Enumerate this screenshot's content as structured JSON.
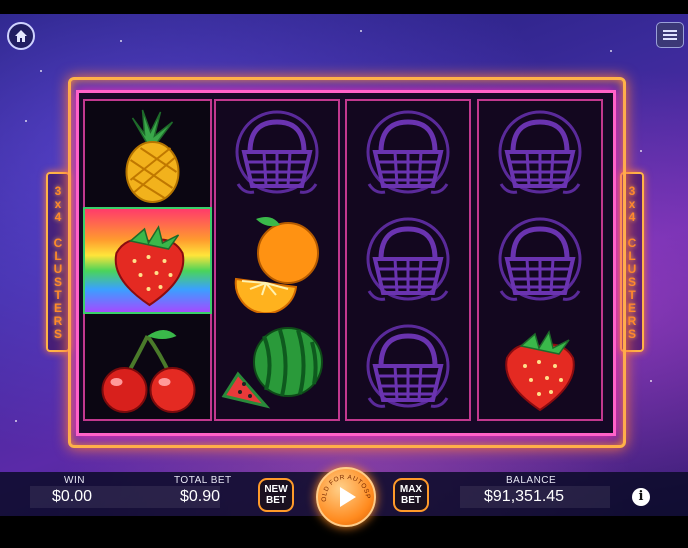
{
  "side_panel": {
    "left_label": "3x4 CLUSTERS",
    "right_label": "3x4 CLUSTERS"
  },
  "reels": [
    [
      "pineapple",
      "strawberry",
      "cherries"
    ],
    [
      "basket",
      "orange",
      "watermelon"
    ],
    [
      "basket",
      "basket",
      "basket"
    ],
    [
      "basket",
      "basket",
      "strawberry"
    ]
  ],
  "highlighted_cell": {
    "reel": 1,
    "row": 2
  },
  "hud": {
    "win_label": "WIN",
    "win_value": "$0.00",
    "total_bet_label": "TOTAL BET",
    "total_bet_value": "$0.90",
    "new_bet_label_1": "NEW",
    "new_bet_label_2": "BET",
    "hold_text": "HOLD FOR AUTOSPIN",
    "max_bet_label_1": "MAX",
    "max_bet_label_2": "BET",
    "balance_label": "BALANCE",
    "balance_value": "$91,351.45",
    "info_label": "i"
  },
  "icons": {
    "home": "home-icon",
    "menu": "menu-icon",
    "spin": "play-icon",
    "info": "info-icon"
  },
  "colors": {
    "frame": "#ffb347",
    "frame_neon": "#ff62c8",
    "button_accent": "#ff9a2a",
    "cluster_text": "#ff8c2a"
  }
}
